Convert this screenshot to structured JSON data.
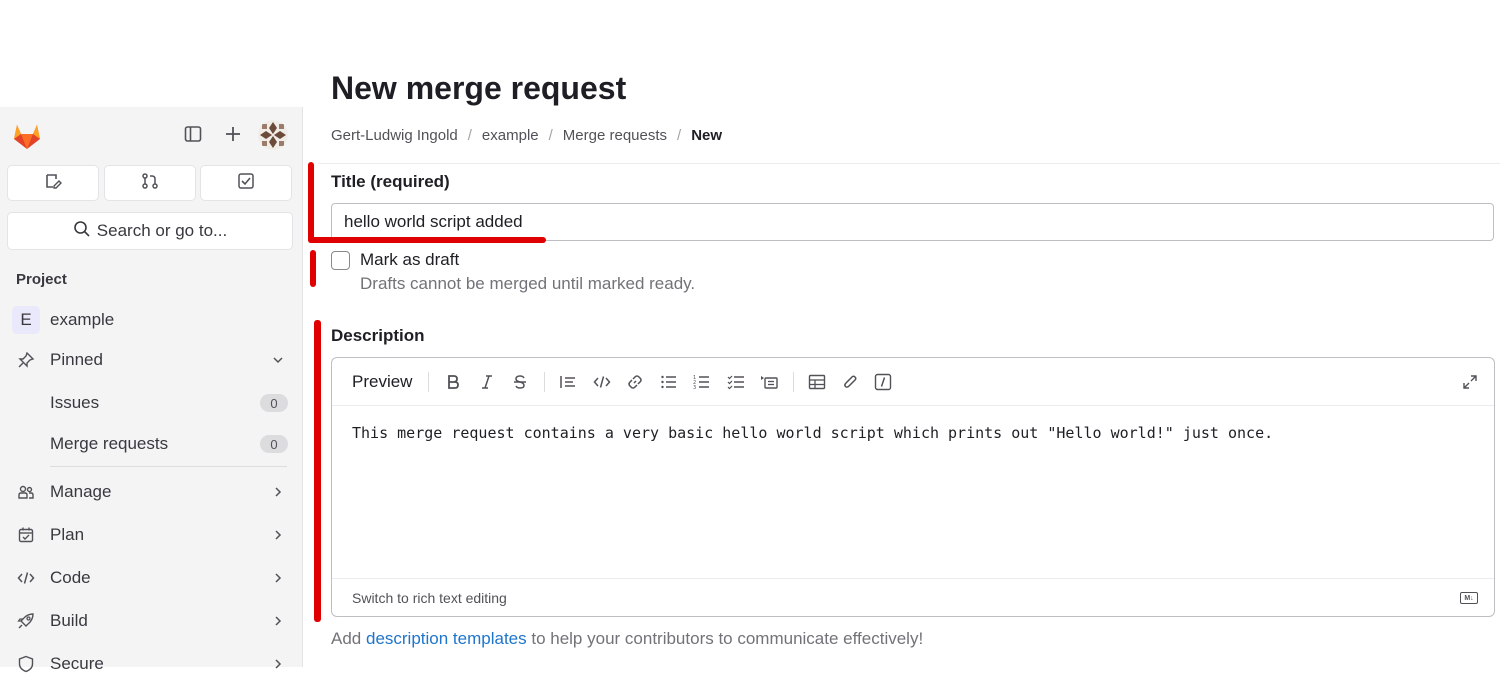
{
  "sidebar": {
    "search_placeholder": "Search or go to...",
    "section_label": "Project",
    "project": {
      "letter": "E",
      "name": "example"
    },
    "pinned_label": "Pinned",
    "pinned_items": [
      {
        "label": "Issues",
        "count": "0"
      },
      {
        "label": "Merge requests",
        "count": "0"
      }
    ],
    "nav": [
      {
        "label": "Manage",
        "icon": "users-icon"
      },
      {
        "label": "Plan",
        "icon": "calendar-icon"
      },
      {
        "label": "Code",
        "icon": "code-icon"
      },
      {
        "label": "Build",
        "icon": "rocket-icon"
      },
      {
        "label": "Secure",
        "icon": "shield-icon"
      }
    ]
  },
  "page": {
    "title": "New merge request",
    "breadcrumb": [
      "Gert-Ludwig Ingold",
      "example",
      "Merge requests",
      "New"
    ]
  },
  "form": {
    "title_label": "Title (required)",
    "title_value": "hello world script added",
    "draft_label": "Mark as draft",
    "draft_help": "Drafts cannot be merged until marked ready.",
    "description_label": "Description",
    "preview_tab": "Preview",
    "description_value": "This merge request contains a very basic hello world script which prints out \"Hello world!\" just once.",
    "switch_label": "Switch to rich text editing",
    "markdown_badge": "M↓",
    "help_prefix": "Add ",
    "help_link": "description templates",
    "help_suffix": " to help your contributors to communicate effectively!"
  },
  "colors": {
    "annotation": "#e00000",
    "link": "#1f75cb",
    "brand_orange": "#fc6d26"
  }
}
